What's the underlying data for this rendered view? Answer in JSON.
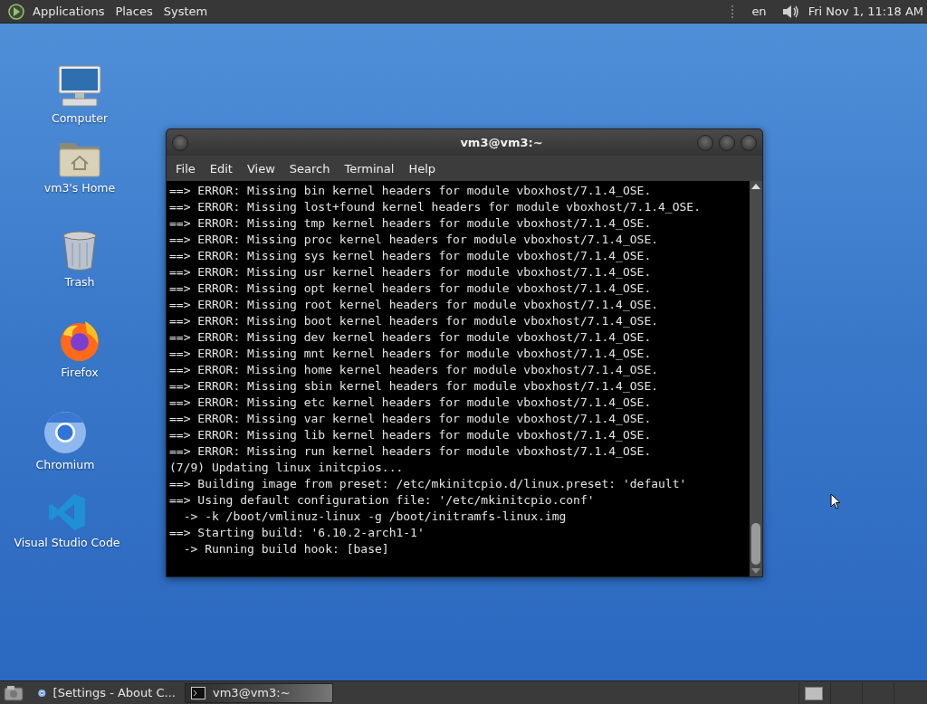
{
  "top_panel": {
    "menus": [
      "Applications",
      "Places",
      "System"
    ],
    "language": "en",
    "clock": "Fri Nov 1, 11:18 AM"
  },
  "desktop_icons": [
    {
      "kind": "computer",
      "label": "Computer"
    },
    {
      "kind": "home",
      "label": "vm3's Home"
    },
    {
      "kind": "trash",
      "label": "Trash"
    },
    {
      "kind": "firefox",
      "label": "Firefox"
    },
    {
      "kind": "chromium",
      "label": "Chromium"
    },
    {
      "kind": "vscode",
      "label": "Visual Studio Code"
    }
  ],
  "terminal": {
    "title": "vm3@vm3:~",
    "menu": [
      "File",
      "Edit",
      "View",
      "Search",
      "Terminal",
      "Help"
    ],
    "lines": [
      "==> ERROR: Missing bin kernel headers for module vboxhost/7.1.4_OSE.",
      "==> ERROR: Missing lost+found kernel headers for module vboxhost/7.1.4_OSE.",
      "==> ERROR: Missing tmp kernel headers for module vboxhost/7.1.4_OSE.",
      "==> ERROR: Missing proc kernel headers for module vboxhost/7.1.4_OSE.",
      "==> ERROR: Missing sys kernel headers for module vboxhost/7.1.4_OSE.",
      "==> ERROR: Missing usr kernel headers for module vboxhost/7.1.4_OSE.",
      "==> ERROR: Missing opt kernel headers for module vboxhost/7.1.4_OSE.",
      "==> ERROR: Missing root kernel headers for module vboxhost/7.1.4_OSE.",
      "==> ERROR: Missing boot kernel headers for module vboxhost/7.1.4_OSE.",
      "==> ERROR: Missing dev kernel headers for module vboxhost/7.1.4_OSE.",
      "==> ERROR: Missing mnt kernel headers for module vboxhost/7.1.4_OSE.",
      "==> ERROR: Missing home kernel headers for module vboxhost/7.1.4_OSE.",
      "==> ERROR: Missing sbin kernel headers for module vboxhost/7.1.4_OSE.",
      "==> ERROR: Missing etc kernel headers for module vboxhost/7.1.4_OSE.",
      "==> ERROR: Missing var kernel headers for module vboxhost/7.1.4_OSE.",
      "==> ERROR: Missing lib kernel headers for module vboxhost/7.1.4_OSE.",
      "==> ERROR: Missing run kernel headers for module vboxhost/7.1.4_OSE.",
      "(7/9) Updating linux initcpios...",
      "==> Building image from preset: /etc/mkinitcpio.d/linux.preset: 'default'",
      "==> Using default configuration file: '/etc/mkinitcpio.conf'",
      "  -> -k /boot/vmlinuz-linux -g /boot/initramfs-linux.img",
      "==> Starting build: '6.10.2-arch1-1'",
      "  -> Running build hook: [base]"
    ]
  },
  "taskbar": {
    "tasks": [
      {
        "kind": "browser",
        "label": "[Settings - About C...",
        "selected": false
      },
      {
        "kind": "terminal",
        "label": "vm3@vm3:~",
        "selected": true
      }
    ]
  }
}
